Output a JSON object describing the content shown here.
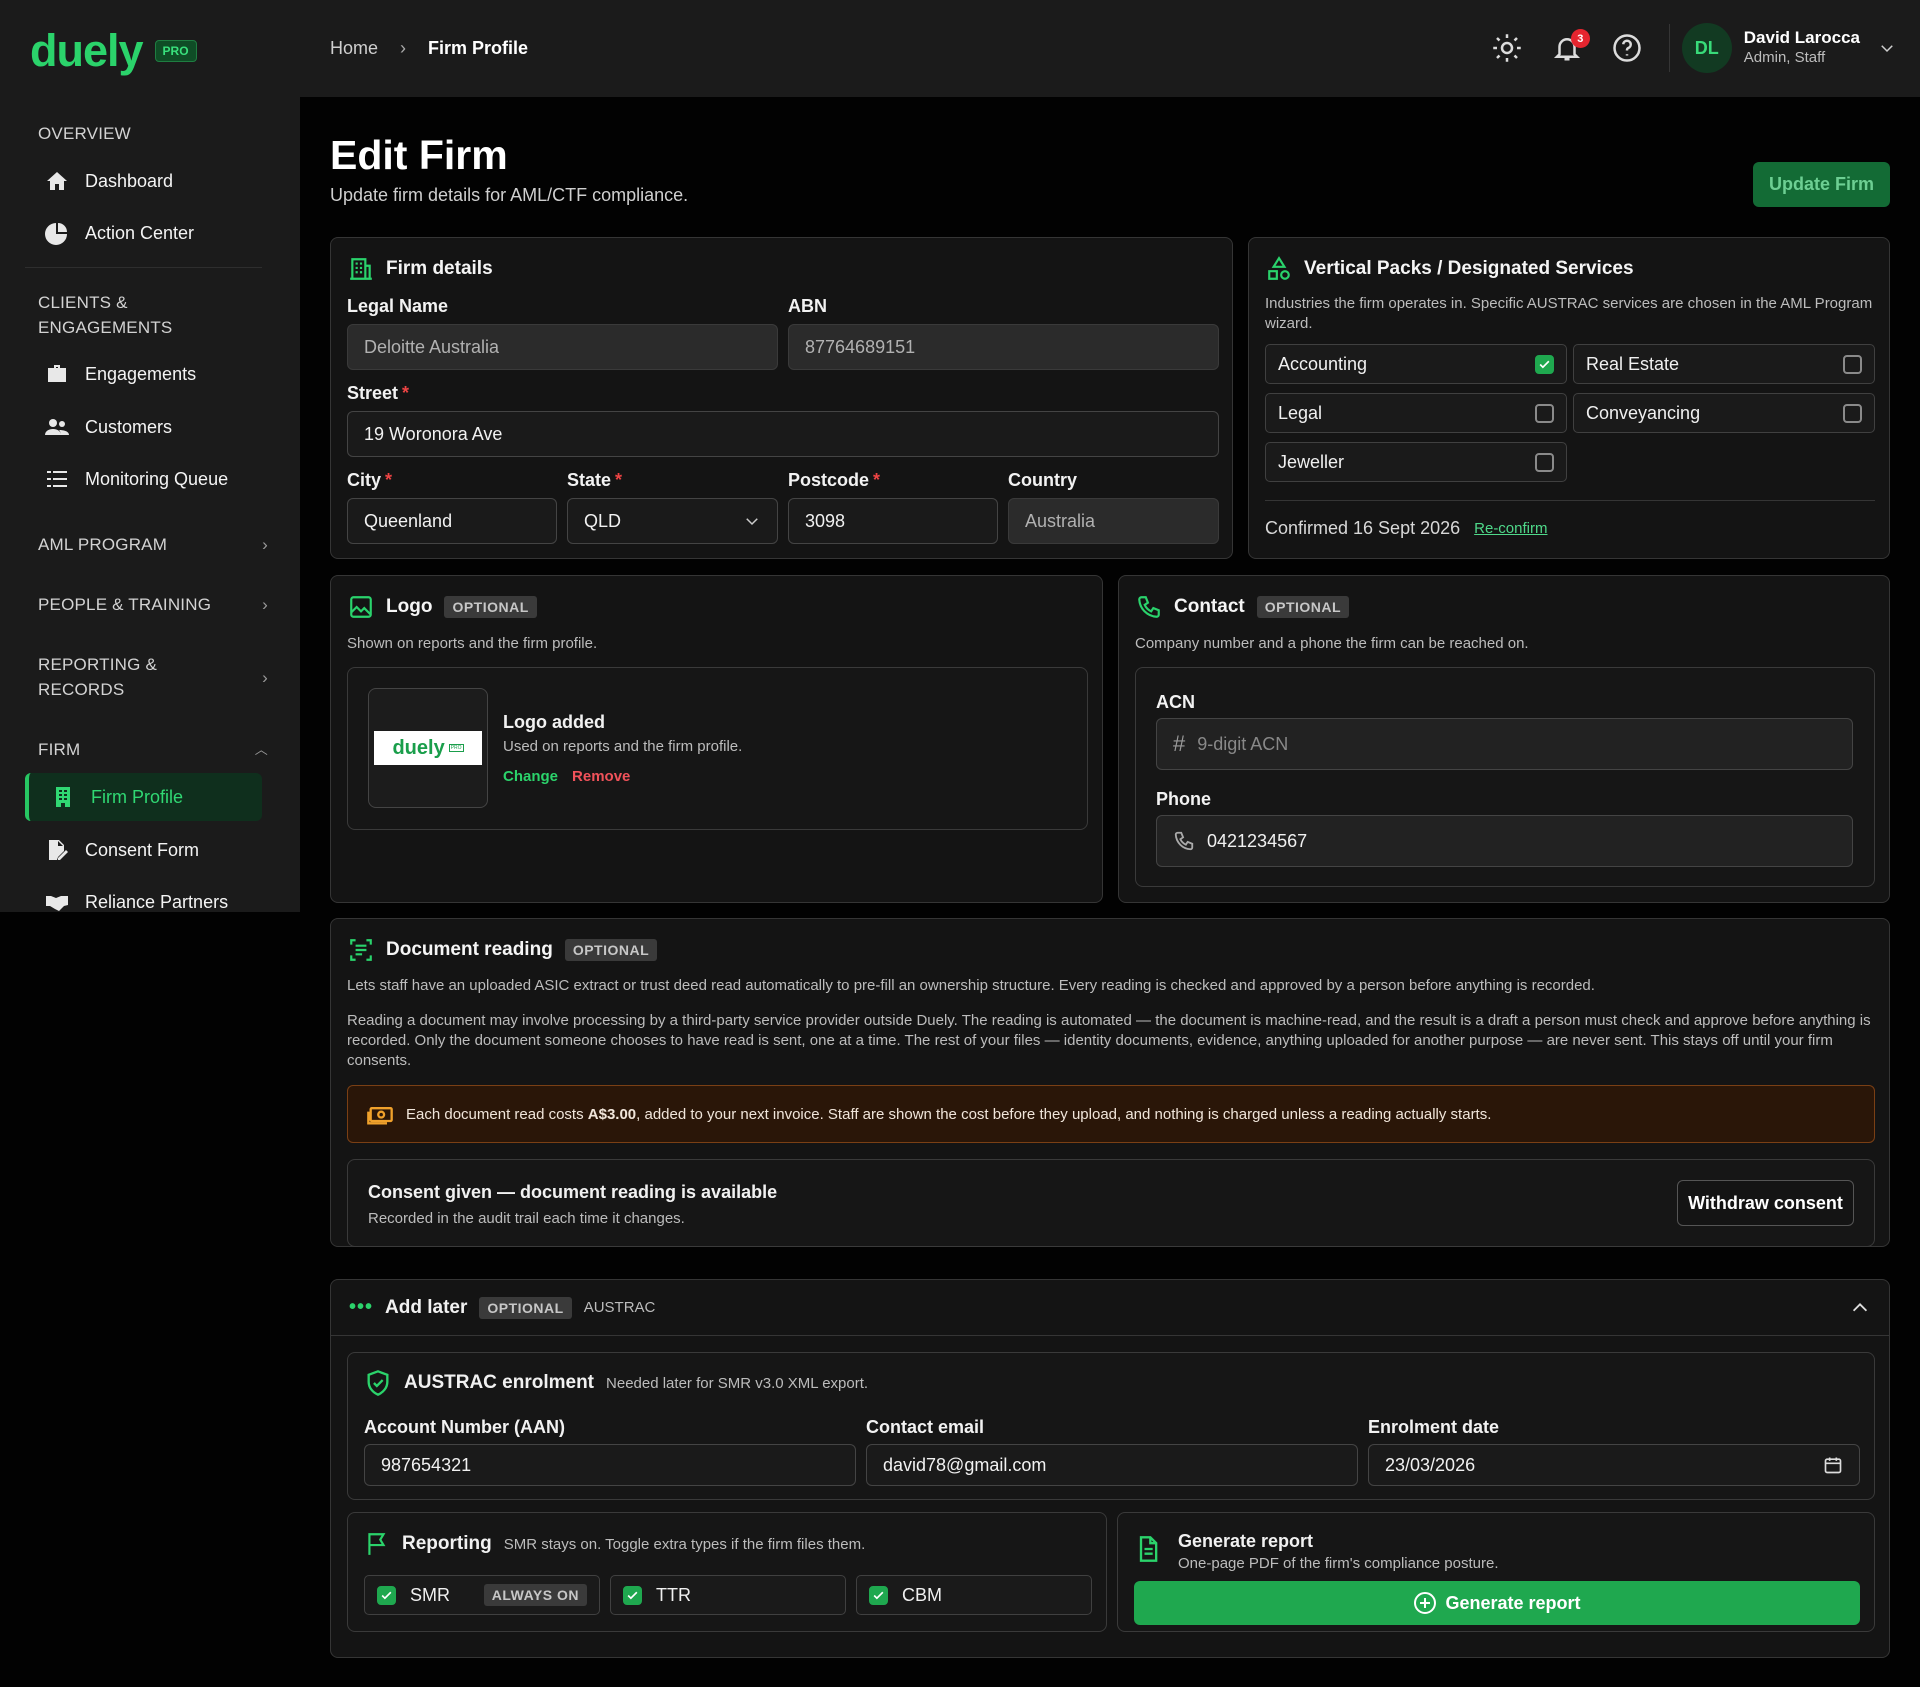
{
  "brand": {
    "name": "duely",
    "badge": "PRO"
  },
  "sidebar": {
    "overview": "OVERVIEW",
    "dashboard": "Dashboard",
    "action_center": "Action Center",
    "clients": "CLIENTS &\nENGAGEMENTS",
    "engagements": "Engagements",
    "customers": "Customers",
    "monitoring": "Monitoring Queue",
    "aml": "AML PROGRAM",
    "people": "PEOPLE & TRAINING",
    "reporting": "REPORTING &\nRECORDS",
    "firm": "FIRM",
    "firm_profile": "Firm Profile",
    "consent_form": "Consent Form",
    "reliance": "Reliance Partners"
  },
  "header": {
    "home": "Home",
    "current": "Firm Profile",
    "notifications": "3",
    "avatar": "DL",
    "user_name": "David Larocca",
    "user_role": "Admin, Staff"
  },
  "page": {
    "title": "Edit Firm",
    "subtitle": "Update firm details for AML/CTF compliance.",
    "update_btn": "Update Firm"
  },
  "firm": {
    "title": "Firm details",
    "legal_name_label": "Legal Name",
    "legal_name": "Deloitte Australia",
    "abn_label": "ABN",
    "abn": "87764689151",
    "street_label": "Street",
    "street": "19 Woronora Ave",
    "city_label": "City",
    "city": "Queenland",
    "state_label": "State",
    "state": "QLD",
    "postcode_label": "Postcode",
    "postcode": "3098",
    "country_label": "Country",
    "country": "Australia"
  },
  "vertical": {
    "title": "Vertical Packs / Designated Services",
    "desc": "Industries the firm operates in. Specific AUSTRAC services are chosen in the AML Program wizard.",
    "items": [
      {
        "label": "Accounting",
        "checked": true
      },
      {
        "label": "Real Estate",
        "checked": false
      },
      {
        "label": "Legal",
        "checked": false
      },
      {
        "label": "Conveyancing",
        "checked": false
      },
      {
        "label": "Jeweller",
        "checked": false
      }
    ],
    "confirmed": "Confirmed 16 Sept 2026",
    "reconfirm": "Re-confirm"
  },
  "logo": {
    "title": "Logo",
    "optional": "OPTIONAL",
    "desc": "Shown on reports and the firm profile.",
    "added": "Logo added",
    "added_desc": "Used on reports and the firm profile.",
    "change": "Change",
    "remove": "Remove",
    "thumb": "duely"
  },
  "contact": {
    "title": "Contact",
    "optional": "OPTIONAL",
    "desc": "Company number and a phone the firm can be reached on.",
    "acn_label": "ACN",
    "acn_placeholder": "9-digit ACN",
    "phone_label": "Phone",
    "phone": "0421234567"
  },
  "docreading": {
    "title": "Document reading",
    "optional": "OPTIONAL",
    "p1": "Lets staff have an uploaded ASIC extract or trust deed read automatically to pre-fill an ownership structure. Every reading is checked and approved by a person before anything is recorded.",
    "p2": "Reading a document may involve processing by a third-party service provider outside Duely. The reading is automated — the document is machine-read, and the result is a draft a person must check and approve before anything is recorded. Only the document someone chooses to have read is sent, one at a time. The rest of your files — identity documents, evidence, anything uploaded for another purpose — are never sent. This stays off until your firm consents.",
    "cost_pre": "Each document read costs ",
    "cost_amt": "A$3.00",
    "cost_post": ", added to your next invoice. Staff are shown the cost before they upload, and nothing is charged unless a reading actually starts.",
    "consent_title": "Consent given — document reading is available",
    "consent_sub": "Recorded in the audit trail each time it changes.",
    "withdraw": "Withdraw consent"
  },
  "later": {
    "title": "Add later",
    "optional": "OPTIONAL",
    "tag": "AUSTRAC",
    "austrac_title": "AUSTRAC enrolment",
    "austrac_note": "Needed later for SMR v3.0 XML export.",
    "aan_label": "Account Number (AAN)",
    "aan": "987654321",
    "email_label": "Contact email",
    "email": "david78@gmail.com",
    "date_label": "Enrolment date",
    "date": "23/03/2026",
    "reporting_title": "Reporting",
    "reporting_note": "SMR stays on. Toggle extra types if the firm files them.",
    "smr": "SMR",
    "always_on": "ALWAYS ON",
    "ttr": "TTR",
    "cbm": "CBM",
    "gen_title": "Generate report",
    "gen_sub": "One-page PDF of the firm's compliance posture.",
    "gen_btn": "Generate report"
  },
  "colors": {
    "accent": "#2bd36b",
    "danger": "#f0525a",
    "warn_bg": "#2a1608"
  }
}
